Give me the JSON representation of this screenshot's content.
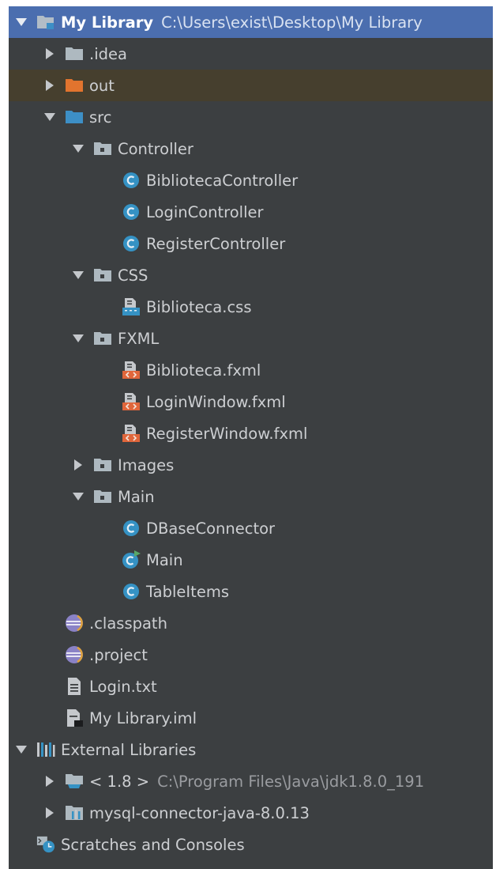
{
  "tree": {
    "root": {
      "label": "My Library",
      "path": "C:\\Users\\exist\\Desktop\\My Library"
    },
    "idea": {
      "label": ".idea"
    },
    "out": {
      "label": "out"
    },
    "src": {
      "label": "src"
    },
    "controller": {
      "label": "Controller"
    },
    "biblioteca_controller": {
      "label": "BibliotecaController"
    },
    "login_controller": {
      "label": "LoginController"
    },
    "register_controller": {
      "label": "RegisterController"
    },
    "css": {
      "label": "CSS"
    },
    "biblioteca_css": {
      "label": "Biblioteca.css"
    },
    "fxml": {
      "label": "FXML"
    },
    "biblioteca_fxml": {
      "label": "Biblioteca.fxml"
    },
    "login_window_fxml": {
      "label": "LoginWindow.fxml"
    },
    "register_window_fxml": {
      "label": "RegisterWindow.fxml"
    },
    "images": {
      "label": "Images"
    },
    "main_pkg": {
      "label": "Main"
    },
    "dbase_connector": {
      "label": "DBaseConnector"
    },
    "main_class": {
      "label": "Main"
    },
    "table_items": {
      "label": "TableItems"
    },
    "classpath": {
      "label": ".classpath"
    },
    "project": {
      "label": ".project"
    },
    "login_txt": {
      "label": "Login.txt"
    },
    "my_library_iml": {
      "label": "My Library.iml"
    },
    "external_libraries": {
      "label": "External Libraries"
    },
    "jdk": {
      "label": "< 1.8 >",
      "path": "C:\\Program Files\\Java\\jdk1.8.0_191"
    },
    "mysql_connector": {
      "label": "mysql-connector-java-8.0.13"
    },
    "scratches": {
      "label": "Scratches and Consoles"
    }
  },
  "colors": {
    "panel_bg": "#3c3f41",
    "selection": "#4b6eaf",
    "excluded_row": "#463f2e",
    "text": "#cdcfd2",
    "folder": "#aeb9c0",
    "source_folder": "#3d8fc6",
    "excluded_folder": "#e2742e",
    "class_icon": "#3592c4",
    "xml_icon": "#e0663b"
  },
  "icons": {
    "expanded": "triangle-down-icon",
    "collapsed": "triangle-right-icon",
    "folder": "folder-icon",
    "package": "package-icon",
    "class": "java-class-icon",
    "main_class": "java-main-class-icon",
    "css": "css-file-icon",
    "fxml": "fxml-file-icon",
    "eclipse": "eclipse-file-icon",
    "text": "text-file-icon",
    "iml": "iml-file-icon",
    "libraries": "libraries-icon",
    "jdk": "jdk-icon",
    "library": "library-jar-icon",
    "scratches": "scratches-icon"
  }
}
